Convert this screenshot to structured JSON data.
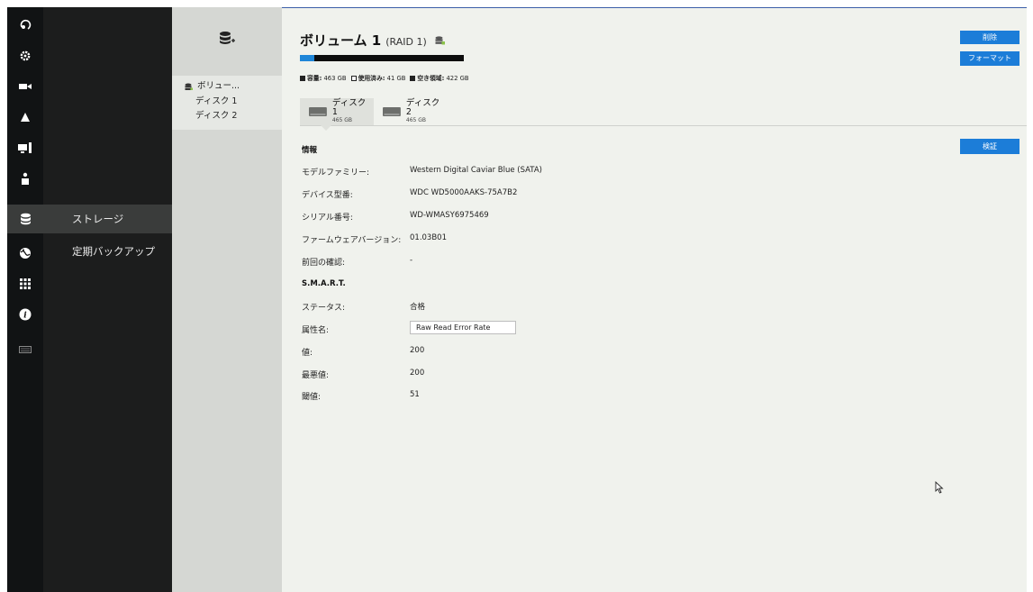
{
  "sidebar": {
    "rail_icons": [
      "playback-icon",
      "gear-icon",
      "camera-icon",
      "alert-icon",
      "monitor-icon",
      "user-icon",
      "storage-icon",
      "network-icon",
      "grid-icon",
      "info-icon",
      "keyboard-icon"
    ],
    "menu_items": [
      {
        "label": "ストレージ",
        "active": true
      },
      {
        "label": "定期バックアップ",
        "active": false
      }
    ]
  },
  "tree": {
    "volume_label": "ボリュー...",
    "disks": [
      "ディスク 1",
      "ディスク 2"
    ]
  },
  "volume": {
    "title": "ボリューム 1",
    "raid": "(RAID 1)",
    "usage_fraction": 0.09,
    "capacity_label": "容量:",
    "capacity_value": "463 GB",
    "used_label": "使用済み:",
    "used_value": "41 GB",
    "free_label": "空き領域:",
    "free_value": "422 GB"
  },
  "buttons": {
    "delete": "削除",
    "format": "フォーマット",
    "verify": "検証"
  },
  "tabs": [
    {
      "name": "ディスク 1",
      "size": "465 GB",
      "active": true
    },
    {
      "name": "ディスク 2",
      "size": "465 GB",
      "active": false
    }
  ],
  "info": {
    "heading": "情報",
    "model_family_label": "モデルファミリー:",
    "model_family_value": "Western Digital Caviar Blue (SATA)",
    "device_model_label": "デバイス型番:",
    "device_model_value": "WDC WD5000AAKS-75A7B2",
    "serial_label": "シリアル番号:",
    "serial_value": "WD-WMASY6975469",
    "firmware_label": "ファームウェアバージョン:",
    "firmware_value": "01.03B01",
    "last_check_label": "前回の確認:",
    "last_check_value": "-"
  },
  "smart": {
    "heading": "S.M.A.R.T.",
    "status_label": "ステータス:",
    "status_value": "合格",
    "attr_label": "属性名:",
    "attr_value": "Raw Read Error Rate",
    "value_label": "値:",
    "value_value": "200",
    "worst_label": "最悪値:",
    "worst_value": "200",
    "threshold_label": "閾値:",
    "threshold_value": "51"
  },
  "colors": {
    "accent": "#1c7dd8",
    "rail_bg": "#111314",
    "menu_bg": "#1c1d1d",
    "active_bg": "#3a3c3b",
    "tree_bg": "#d5d7d3",
    "content_bg": "#f0f2ed"
  }
}
